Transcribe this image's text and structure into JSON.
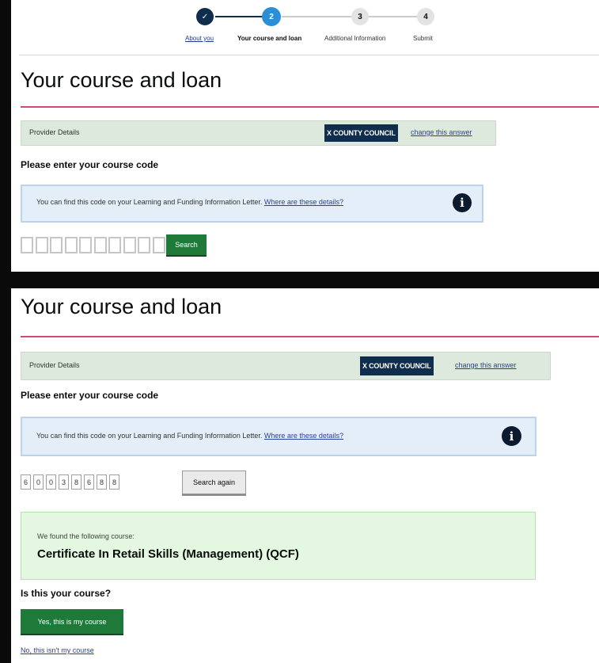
{
  "progress": {
    "steps": [
      {
        "label": "About you",
        "marker": "✓",
        "state": "done"
      },
      {
        "label": "Your course and loan",
        "marker": "2",
        "state": "current"
      },
      {
        "label": "Additional Information",
        "marker": "3",
        "state": "todo"
      },
      {
        "label": "Submit",
        "marker": "4",
        "state": "todo"
      }
    ]
  },
  "page": {
    "title": "Your course and loan"
  },
  "provider": {
    "label": "Provider Details",
    "council": "X COUNTY COUNCIL",
    "change_link": "change this answer"
  },
  "course_code": {
    "question": "Please enter your course code",
    "info_text": "You can find this code on your Learning and Funding Information Letter.",
    "info_link": "Where are these details?",
    "info_icon": "info-icon",
    "digits": [
      "6",
      "0",
      "0",
      "3",
      "8",
      "6",
      "8",
      "8"
    ],
    "search_label": "Search",
    "search_again_label": "Search again"
  },
  "result": {
    "found_text": "We found the following course:",
    "course_name": "Certificate In Retail Skills (Management) (QCF)"
  },
  "confirm": {
    "question": "Is this your course?",
    "yes_label": "Yes, this is my course",
    "no_label": "No, this isn't my course"
  },
  "colors": {
    "accent_pink": "#d1497a",
    "button_green": "#1f7a3a",
    "step_done": "#0f2d4d",
    "step_current": "#2b8fd6",
    "link_blue": "#2b3fa0"
  }
}
